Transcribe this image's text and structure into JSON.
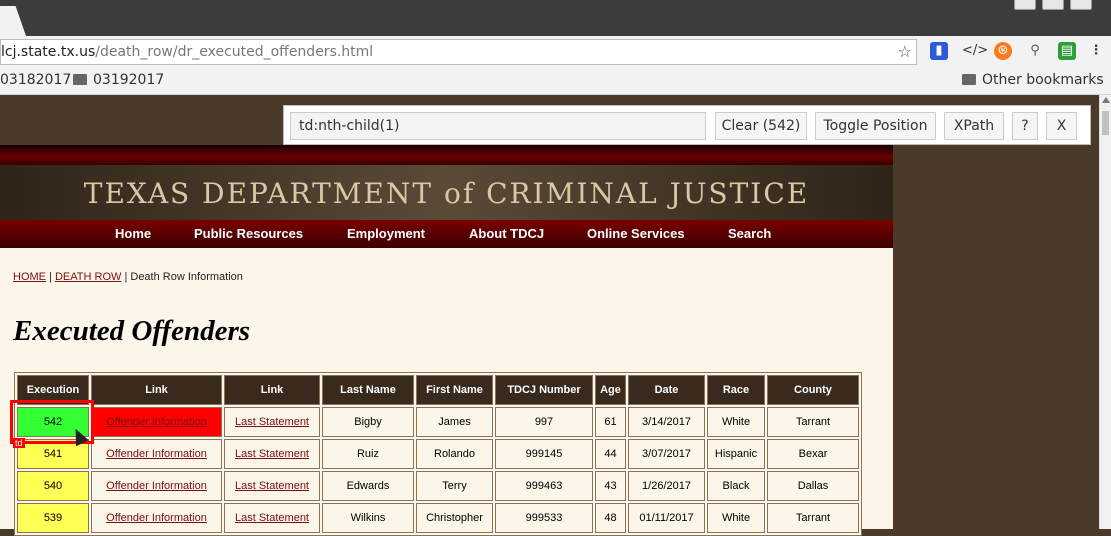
{
  "browser": {
    "url_host": "lcj.state.tx.us",
    "url_path": "/death_row/dr_executed_offenders.html",
    "bookmarks": [
      "03182017",
      "03192017"
    ],
    "other_bookmarks": "Other bookmarks"
  },
  "gadget": {
    "selector": "td:nth-child(1)",
    "clear_label": "Clear (542)",
    "toggle_label": "Toggle Position",
    "xpath_label": "XPath",
    "help_label": "?",
    "close_label": "X"
  },
  "site": {
    "banner_title": "TEXAS DEPARTMENT of CRIMINAL JUSTICE",
    "nav": [
      "Home",
      "Public Resources",
      "Employment",
      "About TDCJ",
      "Online Services",
      "Search"
    ],
    "breadcrumb": {
      "home": "HOME",
      "death_row": "DEATH ROW",
      "separator": " | ",
      "current": "Death Row Information"
    },
    "page_title": "Executed Offenders"
  },
  "table": {
    "headers": [
      "Execution",
      "Link",
      "Link",
      "Last Name",
      "First Name",
      "TDCJ Number",
      "Age",
      "Date",
      "Race",
      "County"
    ],
    "rows": [
      {
        "execution": "542",
        "link1": "Offender Information",
        "link2": "Last Statement",
        "last": "Bigby",
        "first": "James",
        "tdcj": "997",
        "age": "61",
        "date": "3/14/2017",
        "race": "White",
        "county": "Tarrant"
      },
      {
        "execution": "541",
        "link1": "Offender Information",
        "link2": "Last Statement",
        "last": "Ruiz",
        "first": "Rolando",
        "tdcj": "999145",
        "age": "44",
        "date": "3/07/2017",
        "race": "Hispanic",
        "county": "Bexar"
      },
      {
        "execution": "540",
        "link1": "Offender Information",
        "link2": "Last Statement",
        "last": "Edwards",
        "first": "Terry",
        "tdcj": "999463",
        "age": "43",
        "date": "1/26/2017",
        "race": "Black",
        "county": "Dallas"
      },
      {
        "execution": "539",
        "link1": "Offender Information",
        "link2": "Last Statement",
        "last": "Wilkins",
        "first": "Christopher",
        "tdcj": "999533",
        "age": "48",
        "date": "01/11/2017",
        "race": "White",
        "county": "Tarrant"
      }
    ],
    "highlight_tag": "td"
  }
}
